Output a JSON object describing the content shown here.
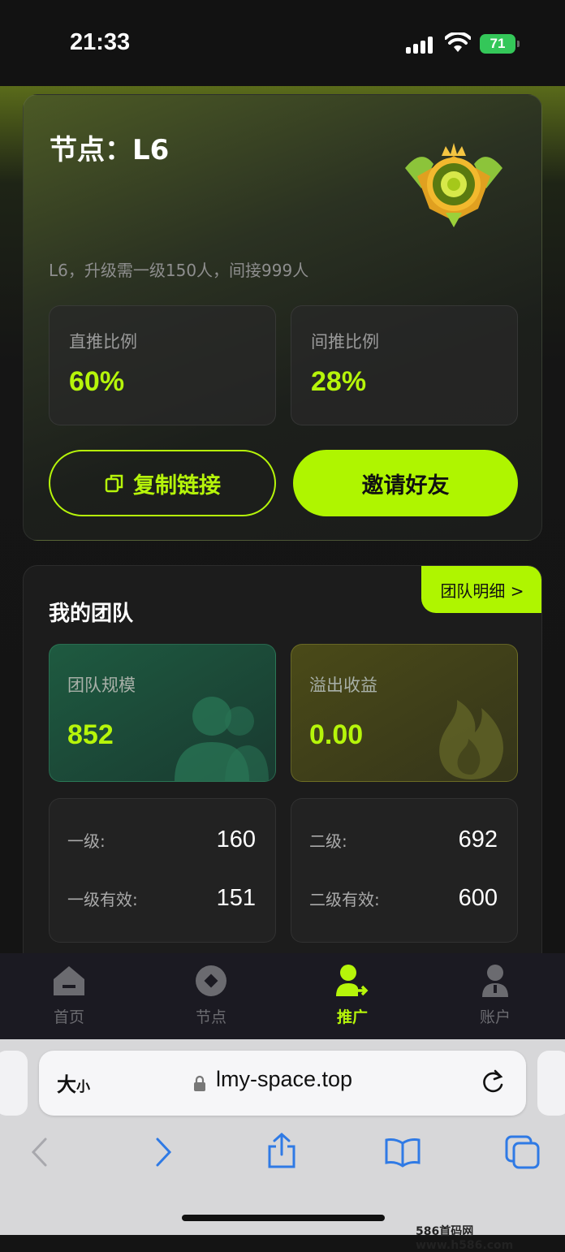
{
  "status": {
    "time": "21:33",
    "battery": "71"
  },
  "node": {
    "title": "节点：L6",
    "desc": "L6，升级需一级150人，间接999人",
    "direct_label": "直推比例",
    "direct_value": "60%",
    "indirect_label": "间推比例",
    "indirect_value": "28%",
    "copy_label": "复制链接",
    "invite_label": "邀请好友"
  },
  "team": {
    "title": "我的团队",
    "detail_link": "团队明细 >",
    "size_label": "团队规模",
    "size_value": "852",
    "overflow_label": "溢出收益",
    "overflow_value": "0.00",
    "l1_label": "一级:",
    "l1_value": "160",
    "l1_valid_label": "一级有效:",
    "l1_valid_value": "151",
    "l2_label": "二级:",
    "l2_value": "692",
    "l2_valid_label": "二级有效:",
    "l2_valid_value": "600"
  },
  "tabs": [
    {
      "label": "首页",
      "icon": "home-icon"
    },
    {
      "label": "节点",
      "icon": "node-icon"
    },
    {
      "label": "推广",
      "icon": "promote-icon"
    },
    {
      "label": "账户",
      "icon": "account-icon"
    }
  ],
  "browser": {
    "aa_big": "大",
    "aa_small": "小",
    "url": "lmy-space.top"
  },
  "watermark": "586首码网 www.h586.com",
  "colors": {
    "accent": "#aff500",
    "bg": "#141414"
  }
}
